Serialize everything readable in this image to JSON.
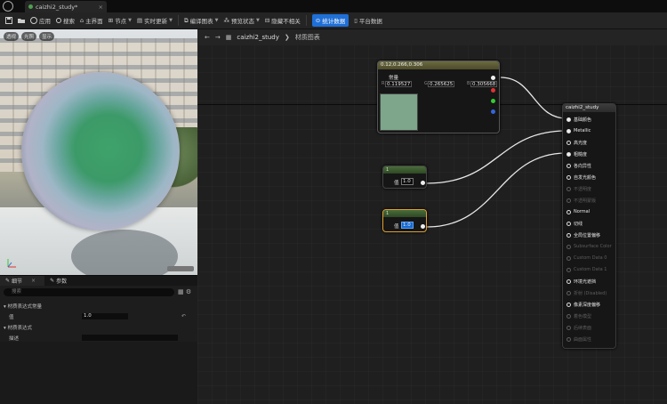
{
  "tab": {
    "title": "caizhi2_study*"
  },
  "toolbar": {
    "items": [
      "保存",
      "在内容浏览器中浏览",
      "应用",
      "搜索",
      "主界面",
      "节点",
      "实时更新",
      "编译图表",
      "预览状态",
      "隐藏不相关"
    ],
    "active_label": "统计数据",
    "last_label": "平台数据"
  },
  "viewport": {
    "tags": [
      "透视",
      "光照",
      "显示"
    ]
  },
  "details": {
    "tabs": [
      "细节",
      "参数"
    ],
    "search_placeholder": "搜索",
    "section1": "材质表达式常量",
    "row1_label": "值",
    "row1_value": "1.0",
    "section2": "材质表达式",
    "row2_label": "描述"
  },
  "graph": {
    "breadcrumb_root": "caizhi2_study",
    "breadcrumb_leaf": "材质图表"
  },
  "color_node": {
    "title": "0.12,0.266,0.306",
    "value_label": "常量",
    "r": "0.119527",
    "g": "0.265625",
    "b": "0.305668"
  },
  "const_nodes": [
    {
      "title": "1",
      "value_label": "值",
      "value": "1.0"
    },
    {
      "title": "1",
      "value_label": "值",
      "value": "1.0"
    }
  ],
  "result_node": {
    "title": "caizhi2_study",
    "inputs": [
      {
        "label": "基础颜色",
        "active": true,
        "connected": true
      },
      {
        "label": "Metallic",
        "active": true,
        "connected": true
      },
      {
        "label": "高光度",
        "active": true,
        "connected": false
      },
      {
        "label": "粗糙度",
        "active": true,
        "connected": true
      },
      {
        "label": "各向异性",
        "active": true,
        "connected": false
      },
      {
        "label": "自发光颜色",
        "active": true,
        "connected": false
      },
      {
        "label": "不透明度",
        "active": false,
        "connected": false
      },
      {
        "label": "不透明蒙版",
        "active": false,
        "connected": false
      },
      {
        "label": "Normal",
        "active": true,
        "connected": false
      },
      {
        "label": "切线",
        "active": true,
        "connected": false
      },
      {
        "label": "全局位置偏移",
        "active": true,
        "connected": false
      },
      {
        "label": "Subsurface Color",
        "active": false,
        "connected": false
      },
      {
        "label": "Custom Data 0",
        "active": false,
        "connected": false
      },
      {
        "label": "Custom Data 1",
        "active": false,
        "connected": false
      },
      {
        "label": "环境光遮挡",
        "active": true,
        "connected": false
      },
      {
        "label": "折射 (Disabled)",
        "active": false,
        "connected": false
      },
      {
        "label": "像素深度偏移",
        "active": true,
        "connected": false
      },
      {
        "label": "着色模型",
        "active": false,
        "connected": false
      },
      {
        "label": "后续表面",
        "active": false,
        "connected": false
      },
      {
        "label": "曲面属性",
        "active": false,
        "connected": false
      }
    ]
  },
  "colors": {
    "accent": "#1f6fd6",
    "selected_border": "#e0a030",
    "swatch": "#7da68a"
  }
}
